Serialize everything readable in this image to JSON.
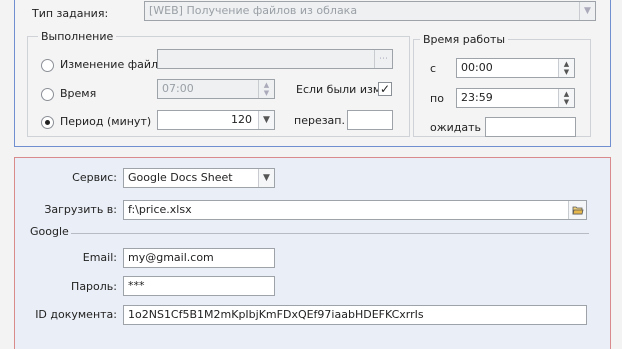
{
  "top": {
    "task_type_label": "Тип задания:",
    "task_type_value": "[WEB] Получение файлов из облака",
    "execution": {
      "title": "Выполнение",
      "file_change_label": "Изменение файла",
      "file_path_value": "",
      "time_label": "Время",
      "time_value": "07:00",
      "period_label": "Период (минут)",
      "period_value": "120",
      "selected_mode": "period",
      "if_changed_label": "Если были изм.",
      "if_changed_checked": true,
      "restart_label": "перезап.",
      "restart_value": ""
    },
    "work_time": {
      "title": "Время работы",
      "from_label": "с",
      "from_value": "00:00",
      "to_label": "по",
      "to_value": "23:59",
      "wait_label": "ожидать",
      "wait_value": ""
    }
  },
  "bottom": {
    "service_label": "Сервис:",
    "service_value": "Google Docs Sheet",
    "load_to_label": "Загрузить в:",
    "load_to_value": "f:\\price.xlsx",
    "google_section_title": "Google",
    "email_label": "Email:",
    "email_value": "my@gmail.com",
    "password_label": "Пароль:",
    "password_value": "***",
    "doc_id_label": "ID документа:",
    "doc_id_value": "1o2NS1Cf5B1M2mKpIbjKmFDxQEf97iaabHDEFKCxrrIs"
  },
  "icons": {
    "dropdown": "chevron-down-icon",
    "ellipsis": "ellipsis-icon",
    "spin": "spin-updown-icon",
    "folder": "open-folder-icon",
    "check": "checkmark-icon"
  },
  "colors": {
    "top_panel_border": "#6f8fd0",
    "bottom_panel_border": "#d98a8a",
    "bottom_panel_bg": "#eaeef6"
  }
}
